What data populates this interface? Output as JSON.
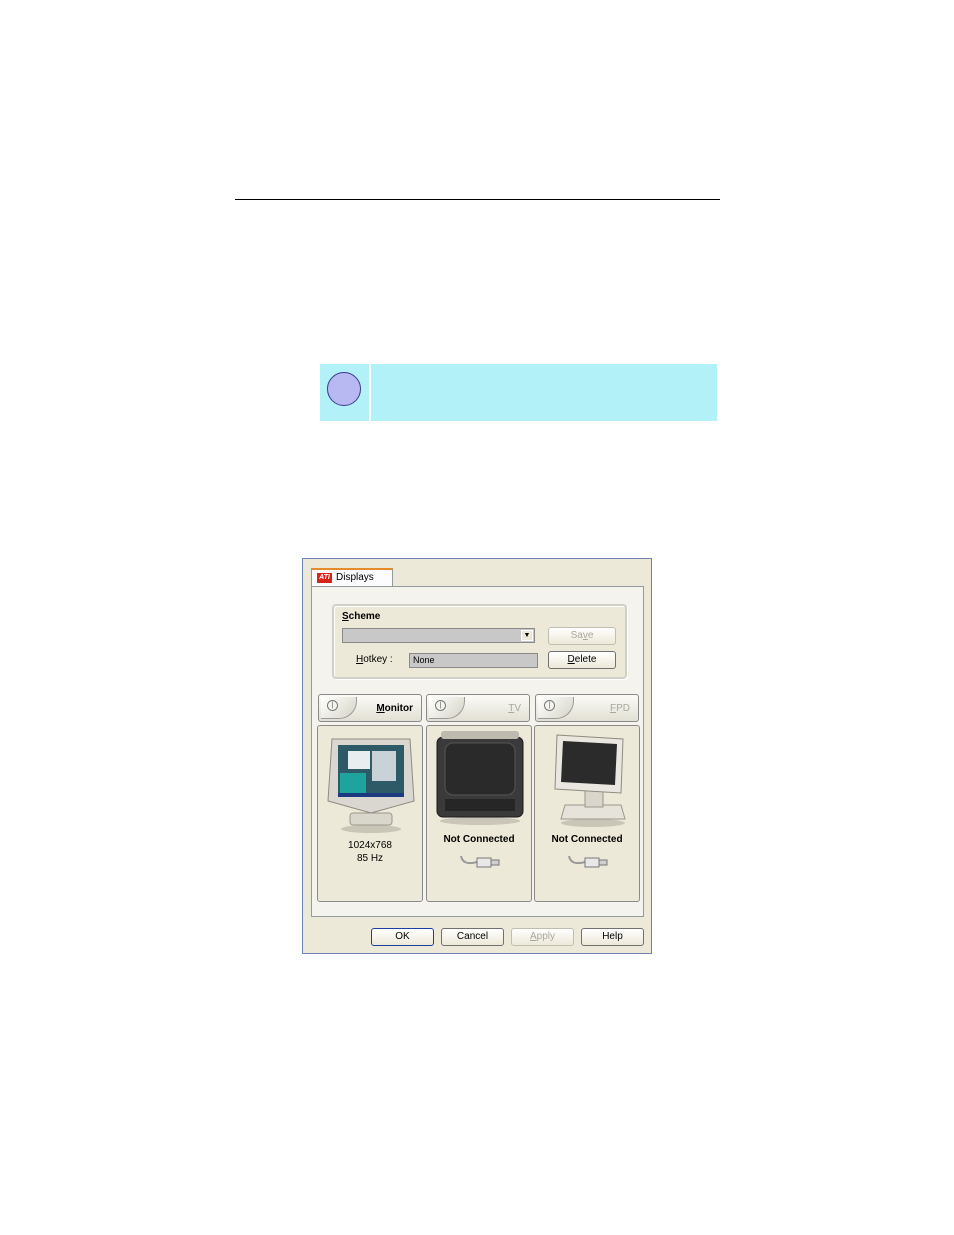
{
  "dialog": {
    "tab_label": "Displays",
    "tab_logo": "ATI",
    "scheme": {
      "label_prefix": "S",
      "label_rest": "cheme",
      "selected_value": "",
      "save_prefix": "Sa",
      "save_u": "v",
      "save_rest": "e",
      "hotkey_u": "H",
      "hotkey_rest": "otkey :",
      "hotkey_value": "None",
      "delete_u": "D",
      "delete_rest": "elete"
    },
    "devices": [
      {
        "u": "M",
        "rest": "onitor",
        "enabled": true,
        "status_line1": "1024x768",
        "status_line2": "85 Hz",
        "icon": "crt-monitor-icon"
      },
      {
        "u": "T",
        "rest": "V",
        "enabled": false,
        "status_line1": "Not Connected",
        "icon": "tv-icon"
      },
      {
        "u": "F",
        "rest": "PD",
        "enabled": false,
        "status_line1": "Not Connected",
        "icon": "flat-panel-icon"
      }
    ],
    "buttons": {
      "ok": "OK",
      "cancel": "Cancel",
      "apply_u": "A",
      "apply_rest": "pply",
      "help": "Help"
    }
  }
}
